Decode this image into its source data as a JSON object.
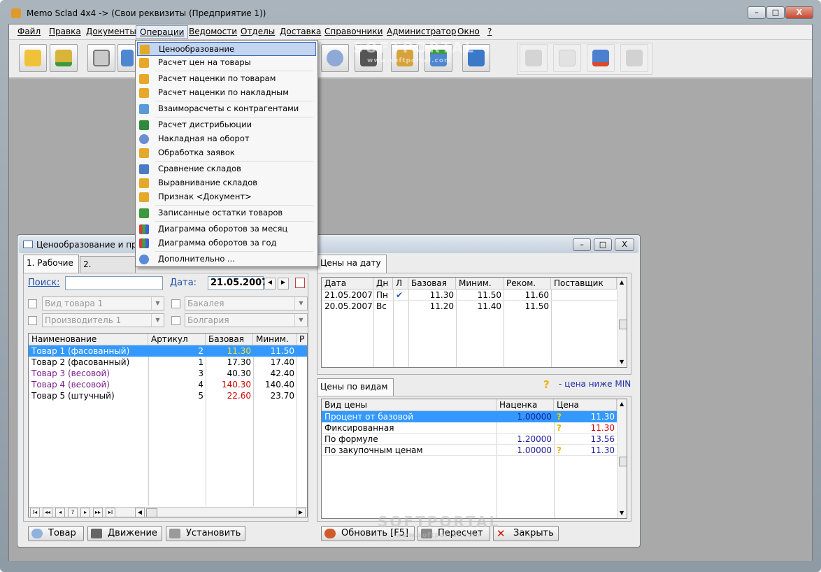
{
  "window": {
    "title": "Memo Sclad 4x4 -> (Свои реквизиты (Предприятие 1))",
    "controls": {
      "minimize": "–",
      "maximize": "□",
      "close": "X"
    }
  },
  "menu": [
    "Файл",
    "Правка",
    "Документы",
    "Операции",
    "Ведомости",
    "Отделы",
    "Доставка",
    "Справочники",
    "Администратор",
    "Окно",
    "?"
  ],
  "dropdown": [
    "Ценообразование",
    "Расчет цен на товары",
    "Расчет наценки по товарам",
    "Расчет наценки по накладным",
    "Взаиморасчеты с контрагентами",
    "Расчет дистрибьюции",
    "Накладная на оборот",
    "Обработка заявок",
    "Сравнение складов",
    "Выравнивание складов",
    "Признак <Документ>",
    "Записанные остатки товаров",
    "Диаграмма оборотов за месяц",
    "Диаграмма оборотов за год",
    "Дополнительно ..."
  ],
  "child": {
    "title": "Ценообразование и прайс",
    "tabs": [
      "1. Рабочие",
      "2. Отмеченн"
    ],
    "right_tab": "Цены на дату",
    "search_label": "Поиск:",
    "search_value": "",
    "date_label": "Дата:",
    "date_value": "21.05.2007",
    "filters": {
      "kind": "Вид товара 1",
      "producer": "Производитель 1",
      "group": "Бакалея",
      "country": "Болгария"
    },
    "goods_headers": [
      "Наименование",
      "Артикул",
      "Базовая",
      "Миним.",
      "Р"
    ],
    "goods": [
      {
        "name": "Товар 1 (фасованный)",
        "art": "2",
        "base": "11.30",
        "min": "11.50"
      },
      {
        "name": "Товар 2 (фасованный)",
        "art": "1",
        "base": "17.30",
        "min": "17.40"
      },
      {
        "name": "Товар 3 (весовой)",
        "art": "3",
        "base": "40.30",
        "min": "42.40"
      },
      {
        "name": "Товар 4 (весовой)",
        "art": "4",
        "base": "140.30",
        "min": "140.40"
      },
      {
        "name": "Товар 5 (штучный)",
        "art": "5",
        "base": "22.60",
        "min": "23.70"
      }
    ],
    "nav": [
      "I◂",
      "◂◂",
      "◂",
      "?",
      "▸",
      "▸▸",
      "▸I"
    ],
    "date_headers": [
      "Дата",
      "Дн",
      "Л",
      "Базовая",
      "Миним.",
      "Реком.",
      "Поставщик"
    ],
    "date_rows": [
      {
        "date": "21.05.2007",
        "day": "Пн",
        "mark": "✔",
        "base": "11.30",
        "min": "11.50",
        "rec": "11.60"
      },
      {
        "date": "20.05.2007",
        "day": "Вс",
        "mark": "",
        "base": "11.20",
        "min": "11.40",
        "rec": "11.50"
      }
    ],
    "types_tab": "Цены по видам",
    "legend": "- цена ниже MIN",
    "legend_icon": "?",
    "types_headers": [
      "Вид цены",
      "Наценка",
      "Цена"
    ],
    "types": [
      {
        "name": "Процент от базовой",
        "markup": "1.00000",
        "warn": "?",
        "price": "11.30"
      },
      {
        "name": "Фиксированная",
        "markup": "",
        "warn": "?",
        "price": "11.30"
      },
      {
        "name": "По формуле",
        "markup": "1.20000",
        "warn": "",
        "price": "13.56"
      },
      {
        "name": "По закупочным ценам",
        "markup": "1.00000",
        "warn": "?",
        "price": "11.30"
      }
    ],
    "buttons_left": [
      "Товар",
      "Движение",
      "Установить"
    ],
    "buttons_right": [
      "Обновить [F5]",
      "Пересчет",
      "Закрыть"
    ]
  },
  "watermark": {
    "brand": "SOFTPORTAL",
    "url": "www.softportal.com"
  }
}
